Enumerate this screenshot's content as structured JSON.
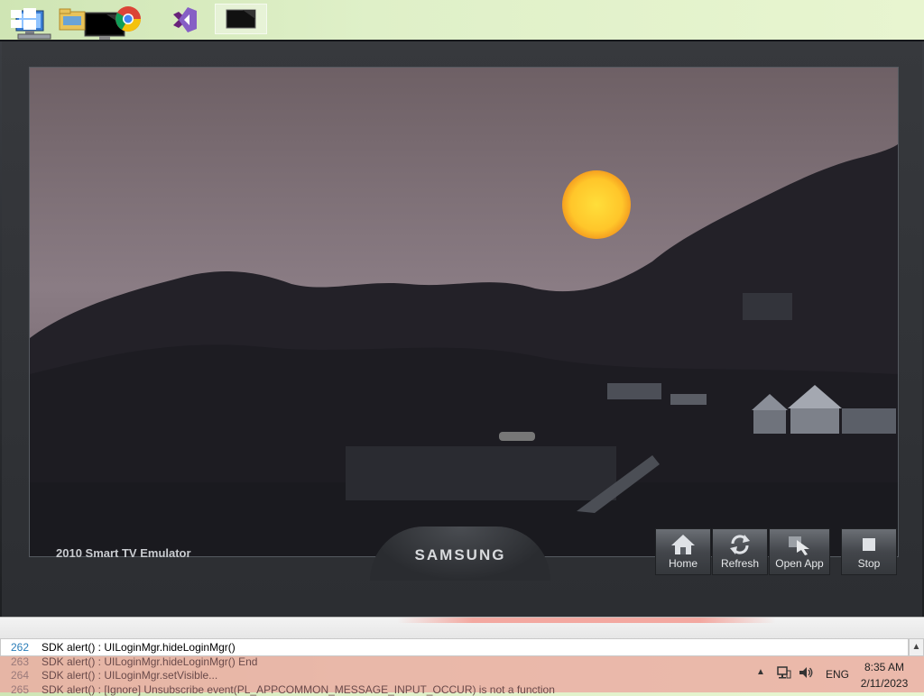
{
  "desktop": {
    "icons": [
      {
        "name": "computer-icon"
      },
      {
        "name": "monitor-icon"
      }
    ]
  },
  "emulator": {
    "title": "2010 Smart TV Emulator",
    "brand": "SAMSUNG",
    "controls": {
      "home": "Home",
      "refresh": "Refresh",
      "open_app": "Open App",
      "stop": "Stop"
    }
  },
  "log": {
    "lines": [
      {
        "num": "262",
        "text": "SDK alert() : UILoginMgr.hideLoginMgr()"
      },
      {
        "num": "263",
        "text": "SDK alert() : UILoginMgr.hideLoginMgr() End"
      },
      {
        "num": "264",
        "text": "SDK alert() : UILoginMgr.setVisible..."
      },
      {
        "num": "265",
        "text": "SDK alert() : [Ignore] Unsubscribe event(PL_APPCOMMON_MESSAGE_INPUT_OCCUR) is not a function"
      }
    ]
  },
  "taskbar": {
    "language": "ENG",
    "time": "8:35 AM",
    "date": "2/11/2023"
  },
  "colors": {
    "accent_log_number": "#2a7db8",
    "taskbar_tint": "#eca8a0"
  }
}
